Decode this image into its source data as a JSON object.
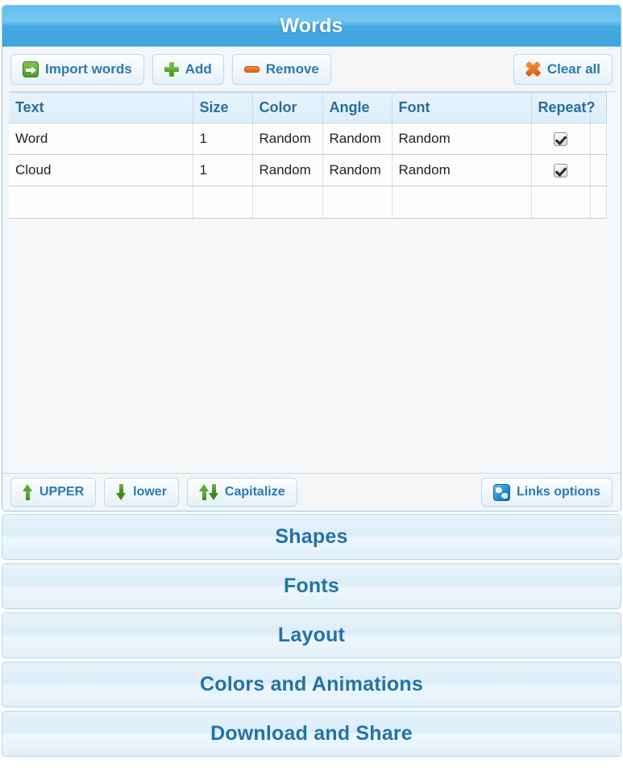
{
  "panel": {
    "title": "Words"
  },
  "toolbar": {
    "import_label": "Import words",
    "add_label": "Add",
    "remove_label": "Remove",
    "clear_all_label": "Clear all"
  },
  "grid": {
    "columns": [
      "Text",
      "Size",
      "Color",
      "Angle",
      "Font",
      "Repeat?",
      ""
    ],
    "rows": [
      {
        "text": "Word",
        "size": "1",
        "color": "Random",
        "angle": "Random",
        "font": "Random",
        "repeat": true
      },
      {
        "text": "Cloud",
        "size": "1",
        "color": "Random",
        "angle": "Random",
        "font": "Random",
        "repeat": true
      },
      {
        "text": "",
        "size": "",
        "color": "",
        "angle": "",
        "font": "",
        "repeat": false
      }
    ]
  },
  "bottom_toolbar": {
    "upper_label": "UPPER",
    "lower_label": "lower",
    "capitalize_label": "Capitalize",
    "links_options_label": "Links options"
  },
  "accordion": {
    "items": [
      {
        "label": "Shapes"
      },
      {
        "label": "Fonts"
      },
      {
        "label": "Layout"
      },
      {
        "label": "Colors and Animations"
      },
      {
        "label": "Download and Share"
      }
    ]
  },
  "colors": {
    "header_blue": "#45a9e2",
    "accent_text": "#2273a8",
    "icon_green": "#4e9a24",
    "icon_orange": "#e0601c",
    "panel_bg": "#f4f5f6"
  }
}
